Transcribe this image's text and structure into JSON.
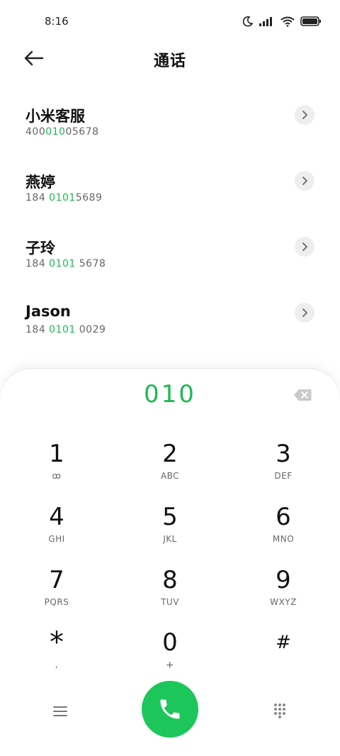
{
  "status_bar": {
    "time": "8:16"
  },
  "header": {
    "title": "通话"
  },
  "results": [
    {
      "name": "小米客服",
      "number_before": "400",
      "number_match": "010",
      "number_after": "05678"
    },
    {
      "name": "燕婷",
      "number_before": "184 ",
      "number_match": "0101",
      "number_after": "5689"
    },
    {
      "name": "子玲",
      "number_before": "184 ",
      "number_match": "0101",
      "number_after": " 5678"
    },
    {
      "name": "Jason",
      "number_before": "184 ",
      "number_match": "0101",
      "number_after": " 0029"
    }
  ],
  "dialer": {
    "entered_number": "010",
    "keys": [
      {
        "digit": "1",
        "letters": "ꝏ"
      },
      {
        "digit": "2",
        "letters": "ABC"
      },
      {
        "digit": "3",
        "letters": "DEF"
      },
      {
        "digit": "4",
        "letters": "GHI"
      },
      {
        "digit": "5",
        "letters": "JKL"
      },
      {
        "digit": "6",
        "letters": "MNO"
      },
      {
        "digit": "7",
        "letters": "PQRS"
      },
      {
        "digit": "8",
        "letters": "TUV"
      },
      {
        "digit": "9",
        "letters": "WXYZ"
      },
      {
        "digit": "*",
        "letters": ","
      },
      {
        "digit": "0",
        "letters": "+"
      },
      {
        "digit": "#",
        "letters": ""
      }
    ]
  },
  "colors": {
    "accent": "#1db954",
    "call_button": "#1dc65a"
  },
  "icons": {
    "back": "arrow-left-icon",
    "chevron": "chevron-right-icon",
    "backspace": "backspace-icon",
    "call": "phone-icon",
    "menu": "menu-icon",
    "dialpad": "dialpad-icon"
  }
}
